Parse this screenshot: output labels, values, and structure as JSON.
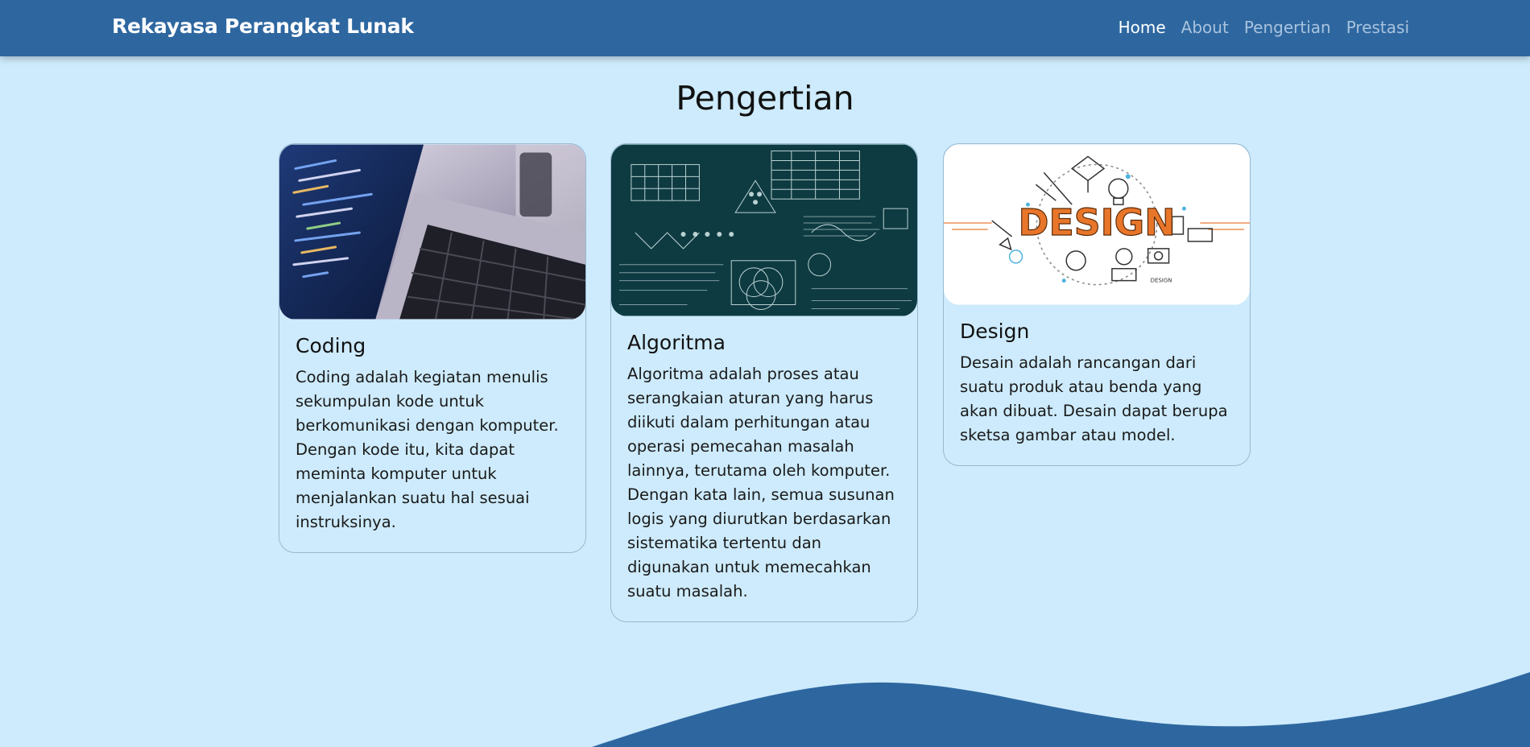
{
  "navbar": {
    "brand": "Rekayasa Perangkat Lunak",
    "links": [
      {
        "label": "Home",
        "active": true
      },
      {
        "label": "About",
        "active": false
      },
      {
        "label": "Pengertian",
        "active": false
      },
      {
        "label": "Prestasi",
        "active": false
      }
    ]
  },
  "section": {
    "title": "Pengertian"
  },
  "cards": [
    {
      "title": "Coding",
      "text": "Coding adalah kegiatan menulis sekumpulan kode untuk berkomunikasi dengan komputer. Dengan kode itu, kita dapat meminta komputer untuk menjalankan suatu hal sesuai instruksinya.",
      "image": "laptop-code-image"
    },
    {
      "title": "Algoritma",
      "text": "Algoritma adalah proses atau serangkaian aturan yang harus diikuti dalam perhitungan atau operasi pemecahan masalah lainnya, terutama oleh komputer. Dengan kata lain, semua susunan logis yang diurutkan berdasarkan sistematika tertentu dan digunakan untuk memecahkan suatu masalah.",
      "image": "algorithm-chalkboard-image"
    },
    {
      "title": "Design",
      "text": "Desain adalah rancangan dari suatu produk atau benda yang akan dibuat. Desain dapat berupa sketsa gambar atau model.",
      "image": "design-illustration-image",
      "image_word": "DESIGN",
      "image_caption": "DESIGN"
    }
  ],
  "colors": {
    "navbar": "#2e67a0",
    "background": "#cdebfc",
    "card_border": "#98b8d2",
    "wave": "#2e67a0",
    "design_orange": "#e8762a"
  }
}
